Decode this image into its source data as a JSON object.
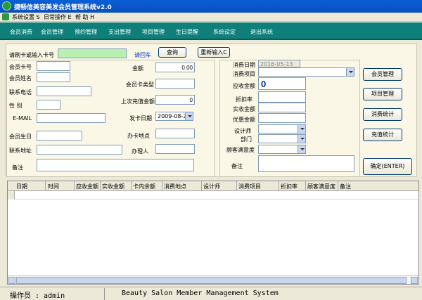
{
  "window": {
    "title": "捷畅信美容美发会员管理系统v2.0"
  },
  "menu": [
    {
      "label": "系统设置 S"
    },
    {
      "label": "日常操作 E"
    },
    {
      "label": "帮 助 H"
    }
  ],
  "nav": [
    {
      "label": "会员消费"
    },
    {
      "label": "会员管理"
    },
    {
      "label": "预约管理"
    },
    {
      "label": "支出管理"
    },
    {
      "label": "项目管理"
    },
    {
      "label": "生日提醒"
    },
    {
      "label": "系统设定"
    },
    {
      "label": "退出系统"
    }
  ],
  "search": {
    "label": "请刷卡或输入卡号",
    "value": "",
    "enter_link": "请回车",
    "query_button": "查询",
    "reset_button": "重新输入C"
  },
  "member": {
    "card_no_label": "会员卡号",
    "card_no": "",
    "name_label": "会员姓名",
    "name": "",
    "phone_label": "联系电话",
    "phone": "",
    "gender_label": "性 别",
    "gender": "",
    "email_label": "E-MAIL",
    "email": "",
    "birthday_label": "会员生日",
    "birthday": "",
    "address_label": "联系地址",
    "address": "",
    "remark_label": "备注",
    "remark": "",
    "amount_label": "金额",
    "amount": "0.00",
    "card_type_label": "会员卡类型",
    "card_type": "",
    "last_recharge_label": "上次充值金额",
    "last_recharge": "0",
    "issue_date_label": "发卡日期",
    "issue_date": "2009-08-27",
    "card_place_label": "办卡地点",
    "card_place": "",
    "handler_label": "办理人",
    "handler": ""
  },
  "consume": {
    "date_label": "消费日期",
    "date": "2016-05-13",
    "item_label": "消费项目",
    "item": "",
    "receivable_label": "应收金额",
    "receivable": "0",
    "discount_label": "折扣率",
    "discount": "",
    "actual_label": "实收金额",
    "actual": "",
    "preferential_label": "优惠金额",
    "preferential": "",
    "designer_label": "设计师",
    "designer": "",
    "dept_label": "部门",
    "dept": "",
    "satisfaction_label": "顾客满意度",
    "satisfaction": "",
    "remark_label": "备注",
    "remark": ""
  },
  "actions": {
    "member_manage": "会员管理",
    "item_manage": "项目管理",
    "consume_stats": "消费统计",
    "recharge_stats": "充值统计",
    "confirm": "确定(ENTER)"
  },
  "table": {
    "columns": [
      "日期",
      "时间",
      "应收金额",
      "实收金额",
      "卡内余额",
      "消费地点",
      "设计师",
      "消费项目",
      "折扣率",
      "顾客满意度",
      "备注"
    ]
  },
  "status": {
    "operator": "操作员 : admin",
    "system_name": "Beauty Salon Member Management System"
  },
  "colors": {
    "nav_bg": "#0e7f7a",
    "title_bg": "#0b4fbf",
    "card_input_bg": "#b8f0b0",
    "receivable_text": "#00339a"
  }
}
